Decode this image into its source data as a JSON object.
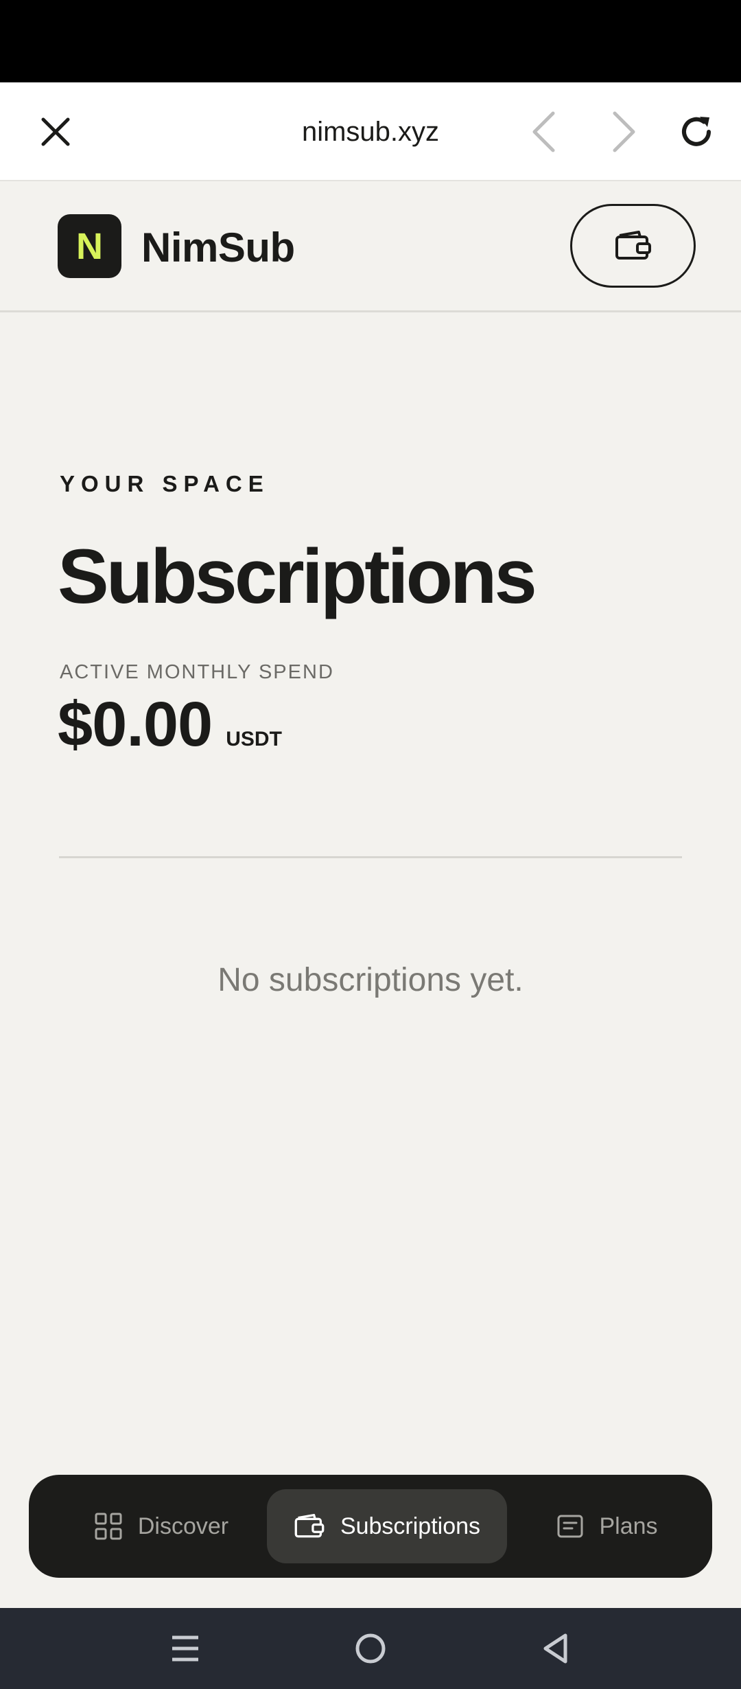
{
  "browser": {
    "url": "nimsub.xyz"
  },
  "header": {
    "logo_letter": "N",
    "brand_name": "NimSub",
    "logo_accent": "#d7f25a"
  },
  "main": {
    "eyebrow": "YOUR SPACE",
    "title": "Subscriptions",
    "spend_label": "ACTIVE MONTHLY SPEND",
    "spend_amount": "$0.00",
    "spend_unit": "USDT",
    "empty_message": "No subscriptions yet."
  },
  "bottom_nav": {
    "items": [
      {
        "label": "Discover",
        "icon": "grid-icon",
        "active": false
      },
      {
        "label": "Subscriptions",
        "icon": "wallet-icon",
        "active": true
      },
      {
        "label": "Plans",
        "icon": "document-icon",
        "active": false
      }
    ]
  },
  "colors": {
    "background": "#f3f2ee",
    "ink": "#1b1b19",
    "nav_bg": "#1c1c1a",
    "nav_active_bg": "#393936"
  }
}
